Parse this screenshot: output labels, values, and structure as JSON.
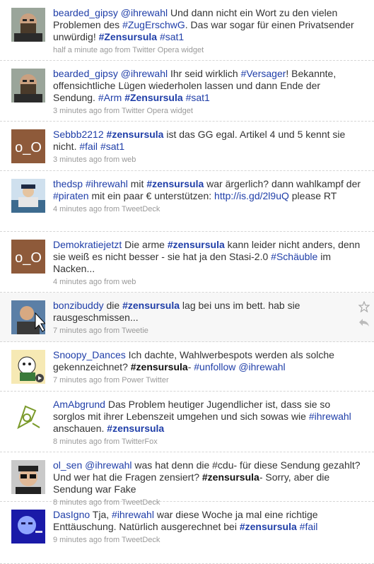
{
  "tweets": [
    {
      "user": "bearded_gipsy",
      "parts": [
        {
          "t": " "
        },
        {
          "t": "@ihrewahl",
          "k": "tag"
        },
        {
          "t": " Und dann nicht ein Wort zu den vielen Problemen des "
        },
        {
          "t": "#ZugErschwG",
          "k": "tag"
        },
        {
          "t": ". Das war sogar für einen Privatsender unwürdig! "
        },
        {
          "t": "#Zensursula",
          "k": "tagb"
        },
        {
          "t": " "
        },
        {
          "t": "#sat1",
          "k": "tag"
        }
      ],
      "meta": "half a minute ago from Twitter Opera widget",
      "avatar": "bearded-man"
    },
    {
      "user": "bearded_gipsy",
      "parts": [
        {
          "t": " "
        },
        {
          "t": "@ihrewahl",
          "k": "tag"
        },
        {
          "t": " Ihr seid wirklich "
        },
        {
          "t": "#Versager",
          "k": "tag"
        },
        {
          "t": "! Bekannte, offensichtliche Lügen wiederholen lassen und dann Ende der Sendung. "
        },
        {
          "t": "#Arm",
          "k": "tag"
        },
        {
          "t": " "
        },
        {
          "t": "#Zensursula",
          "k": "tagb"
        },
        {
          "t": " "
        },
        {
          "t": "#sat1",
          "k": "tag"
        }
      ],
      "meta": "3 minutes ago from Twitter Opera widget",
      "avatar": "bearded-man"
    },
    {
      "user": "Sebbb2212",
      "parts": [
        {
          "t": " "
        },
        {
          "t": "#zensursula",
          "k": "tagb"
        },
        {
          "t": " ist das GG egal. Artikel 4 und 5 kennt sie nicht. "
        },
        {
          "t": "#fail",
          "k": "tag"
        },
        {
          "t": " "
        },
        {
          "t": "#sat1",
          "k": "tag"
        }
      ],
      "meta": "3 minutes ago from web",
      "avatar": "o_O"
    },
    {
      "user": "thedsp",
      "parts": [
        {
          "t": " "
        },
        {
          "t": "#ihrewahl",
          "k": "tag"
        },
        {
          "t": " mit "
        },
        {
          "t": "#zensursula",
          "k": "tagb"
        },
        {
          "t": " war ärgerlich? dann wahlkampf der "
        },
        {
          "t": "#piraten",
          "k": "tag"
        },
        {
          "t": " mit ein paar € unterstützen: "
        },
        {
          "t": "http://is.gd/2l9uQ",
          "k": "link"
        },
        {
          "t": " please RT"
        }
      ],
      "meta": "4 minutes ago from TweetDeck",
      "avatar": "cap-person"
    },
    {
      "user": "Demokratiejetzt",
      "parts": [
        {
          "t": " Die arme "
        },
        {
          "t": "#zensursula",
          "k": "tagb"
        },
        {
          "t": " kann leider nicht anders, denn sie weiß es nicht besser - sie hat ja den Stasi-2.0 "
        },
        {
          "t": "#Schäuble",
          "k": "tag"
        },
        {
          "t": " im Nacken..."
        }
      ],
      "meta": "4 minutes ago from web",
      "avatar": "o_O"
    },
    {
      "user": "bonzibuddy",
      "parts": [
        {
          "t": " die "
        },
        {
          "t": "#zensursula",
          "k": "tagb"
        },
        {
          "t": " lag bei uns im bett. hab sie rausgeschmissen..."
        }
      ],
      "meta": "7 minutes ago from Tweetie",
      "avatar": "cursor-person",
      "hover": true
    },
    {
      "user": "Snoopy_Dances",
      "parts": [
        {
          "t": " Ich dachte, Wahlwerbespots werden als solche gekennzeichnet? "
        },
        {
          "t": "#zensursula",
          "k": "bold"
        },
        {
          "t": "- "
        },
        {
          "t": "#unfollow",
          "k": "tag"
        },
        {
          "t": " "
        },
        {
          "t": "@ihrewahl",
          "k": "tag"
        }
      ],
      "meta": "7 minutes ago from Power Twitter",
      "avatar": "cartoon"
    },
    {
      "user": "AmAbgrund",
      "parts": [
        {
          "t": " Das Problem heutiger Jugendlicher ist, dass sie so sorglos mit ihrer Lebenszeit umgehen und sich sowas wie "
        },
        {
          "t": "#ihrewahl",
          "k": "tag"
        },
        {
          "t": " anschauen. "
        },
        {
          "t": "#zensursula",
          "k": "tagb"
        }
      ],
      "meta": "8 minutes ago from TwitterFox",
      "avatar": "sketch"
    },
    {
      "user": "ol_sen",
      "parts": [
        {
          "t": " "
        },
        {
          "t": "@ihrewahl",
          "k": "tag"
        },
        {
          "t": " was hat denn die #cdu- für diese Sendung gezahlt? Und wer hat die Fragen zensiert? "
        },
        {
          "t": "#zensursula",
          "k": "bold"
        },
        {
          "t": "- Sorry, aber die Sendung war Fake"
        }
      ],
      "meta": "8 minutes ago from TweetDeck",
      "avatar": "glasses-man"
    },
    {
      "user": "DasIgno",
      "parts": [
        {
          "t": " Tja, "
        },
        {
          "t": "#ihrewahl",
          "k": "tag"
        },
        {
          "t": " war diese Woche ja mal eine richtige Enttäuschung. Natürlich ausgerechnet bei "
        },
        {
          "t": "#zensursula",
          "k": "tagb"
        },
        {
          "t": " "
        },
        {
          "t": "#fail",
          "k": "tag"
        }
      ],
      "meta": "9 minutes ago from TweetDeck",
      "avatar": "blue-face"
    }
  ],
  "colors": {
    "link": "#1f3ea8",
    "meta": "#999999"
  }
}
